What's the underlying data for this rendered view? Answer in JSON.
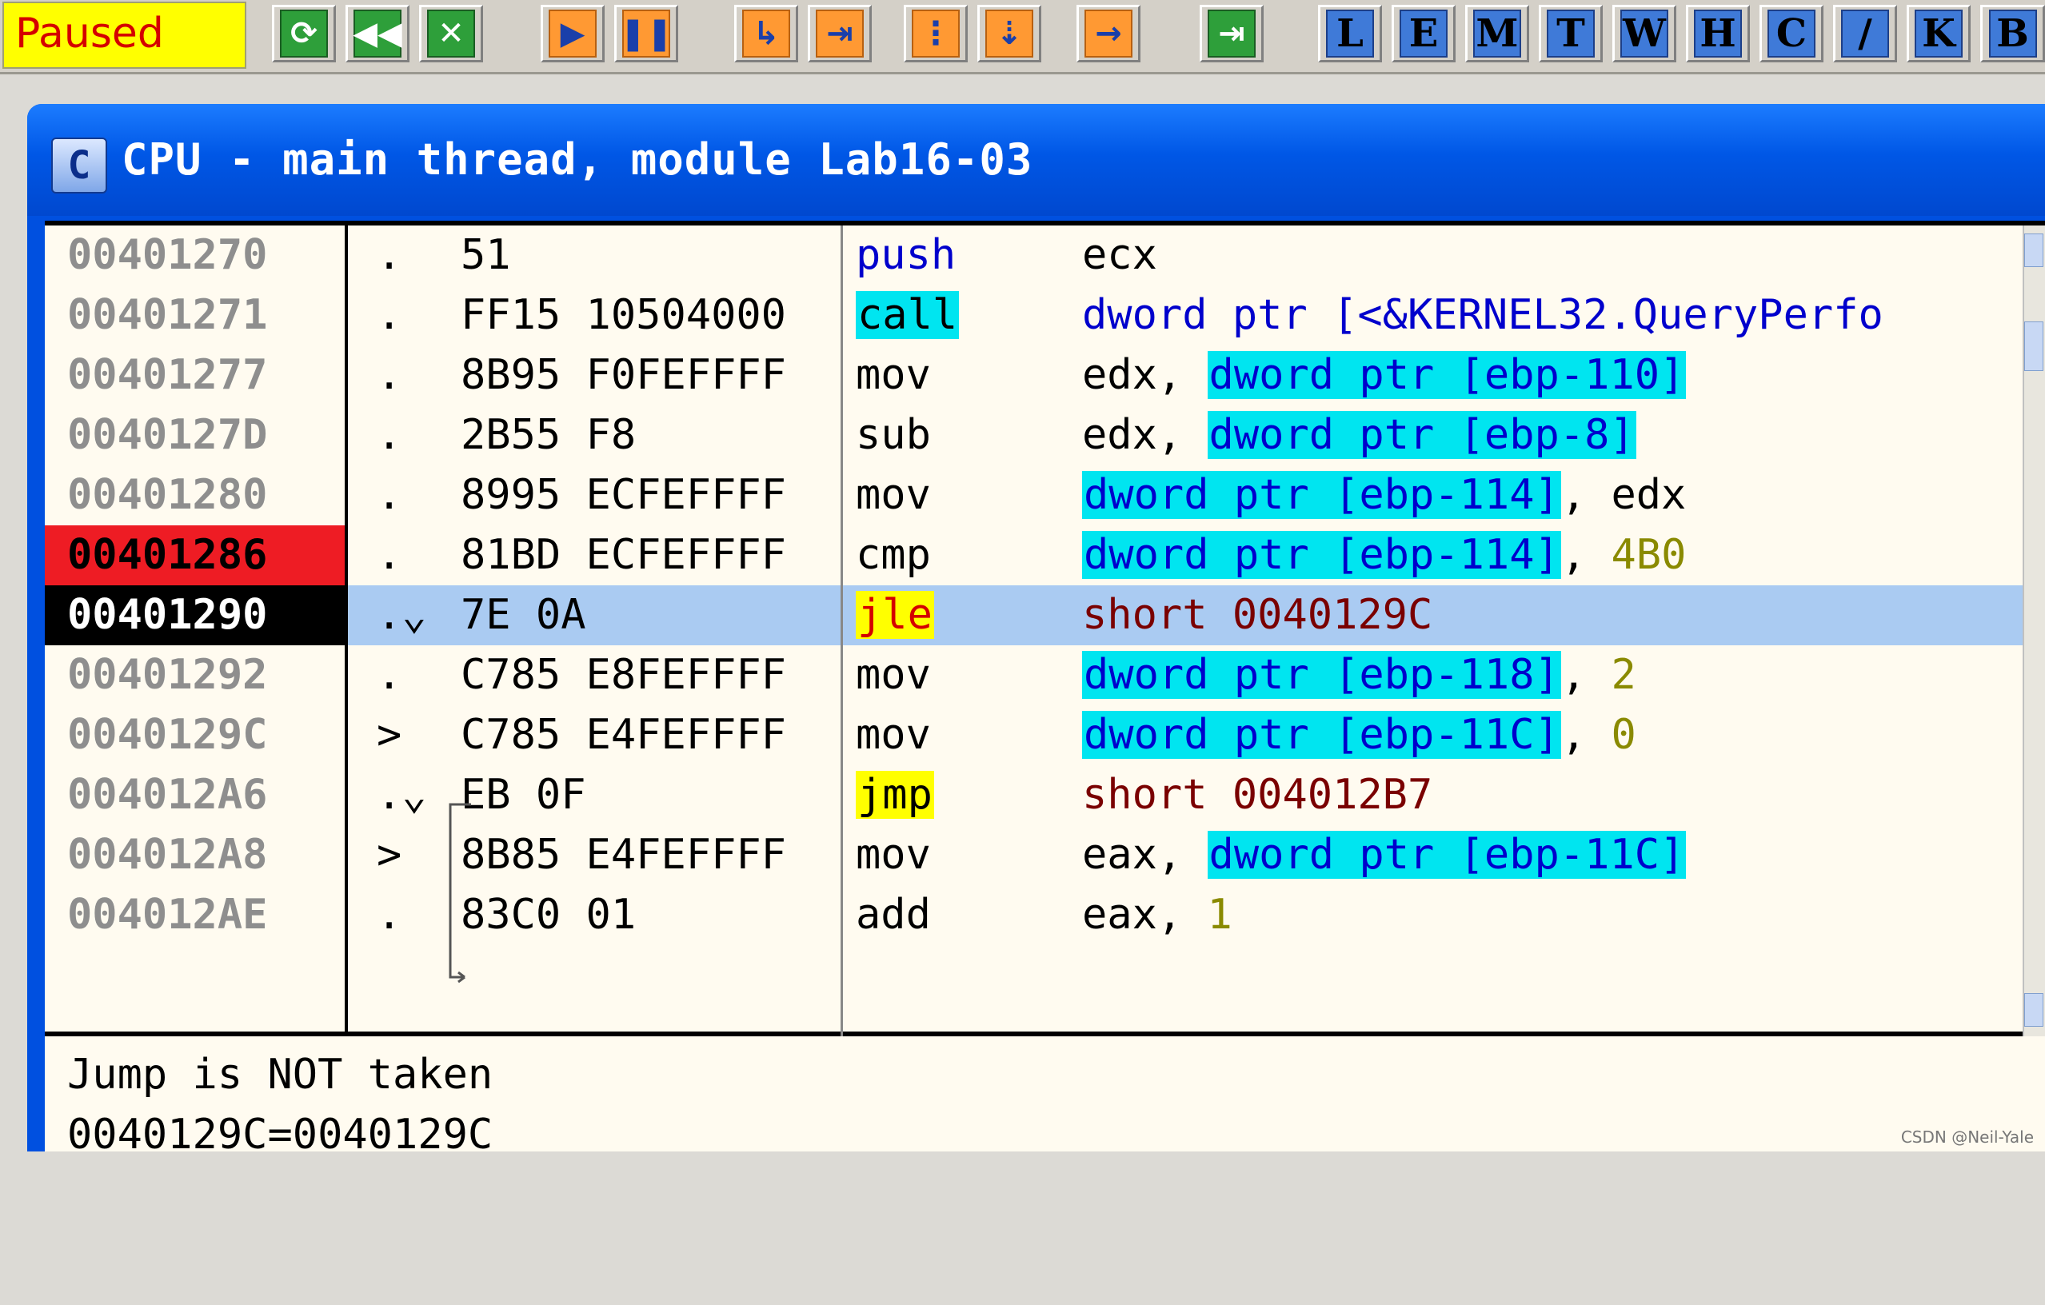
{
  "toolbar": {
    "status": "Paused",
    "letter_buttons": [
      "L",
      "E",
      "M",
      "T",
      "W",
      "H",
      "C",
      "/",
      "K",
      "B"
    ]
  },
  "window": {
    "title": "CPU - main thread, module Lab16-03",
    "icon_letter": "C"
  },
  "disasm": {
    "rows": [
      {
        "addr": "00401270",
        "mark": ".",
        "hex": "51",
        "mnem": "push",
        "operand_html": "ecx"
      },
      {
        "addr": "00401271",
        "mark": ".",
        "hex": "FF15 10504000",
        "mnem": "call",
        "operand": "dword ptr [<&KERNEL32.QueryPerfo"
      },
      {
        "addr": "00401277",
        "mark": ".",
        "hex": "8B95 F0FEFFFF",
        "mnem": "mov",
        "operand_pre": "edx, ",
        "operand_hl": "dword ptr [ebp-110]"
      },
      {
        "addr": "0040127D",
        "mark": ".",
        "hex": "2B55 F8",
        "mnem": "sub",
        "operand_pre": "edx, ",
        "operand_hl": "dword ptr [ebp-8]"
      },
      {
        "addr": "00401280",
        "mark": ".",
        "hex": "8995 ECFEFFFF",
        "mnem": "mov",
        "operand_hl": "dword ptr [ebp-114]",
        "operand_post": ", edx"
      },
      {
        "addr": "00401286",
        "mark": ".",
        "hex": "81BD ECFEFFFF",
        "mnem": "cmp",
        "operand_hl": "dword ptr [ebp-114]",
        "operand_post": ", ",
        "operand_num": "4B0"
      },
      {
        "addr": "00401290",
        "mark": ".⌄",
        "hex": "7E 0A",
        "mnem": "jle",
        "operand": "short 0040129C"
      },
      {
        "addr": "00401292",
        "mark": ".",
        "hex": "C785 E8FEFFFF",
        "mnem": "mov",
        "operand_hl": "dword ptr [ebp-118]",
        "operand_post": ", ",
        "operand_num": "2"
      },
      {
        "addr": "0040129C",
        "mark": ">",
        "hex": "C785 E4FEFFFF",
        "mnem": "mov",
        "operand_hl": "dword ptr [ebp-11C]",
        "operand_post": ", ",
        "operand_num": "0"
      },
      {
        "addr": "004012A6",
        "mark": ".⌄",
        "hex": "EB 0F",
        "mnem": "jmp",
        "operand": "short 004012B7"
      },
      {
        "addr": "004012A8",
        "mark": ">",
        "hex": "8B85 E4FEFFFF",
        "mnem": "mov",
        "operand_pre": "eax, ",
        "operand_hl": "dword ptr [ebp-11C]"
      },
      {
        "addr": "004012AE",
        "mark": ".",
        "hex": "83C0 01",
        "mnem": "add",
        "operand_pre": "eax, ",
        "operand_num": "1"
      }
    ]
  },
  "info": {
    "line1": "Jump is NOT taken",
    "line2": "0040129C=0040129C"
  },
  "watermark": "CSDN @Neil-Yale",
  "colors": {
    "cyan_highlight": "#00e5f0",
    "yellow_highlight": "#ffff00",
    "breakpoint_red": "#ee1c24",
    "selected_row": "#aacbf2"
  }
}
